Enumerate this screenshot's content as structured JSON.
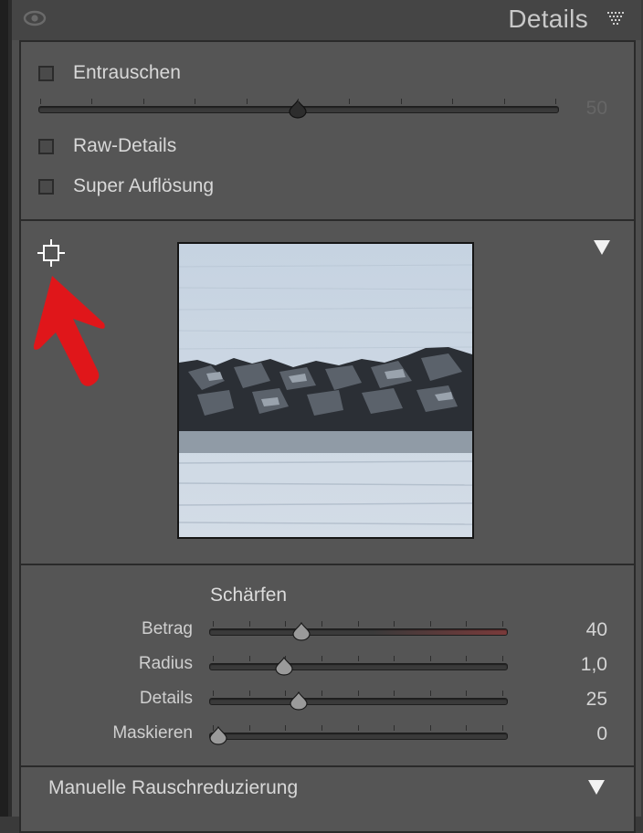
{
  "header": {
    "title": "Details"
  },
  "noise": {
    "checkbox_label": "Entrauschen",
    "slider_value": "50",
    "slider_fraction": 0.5
  },
  "raw_details": {
    "label": "Raw-Details"
  },
  "super_res": {
    "label": "Super Auflösung"
  },
  "sharpening": {
    "title": "Schärfen",
    "sliders": [
      {
        "label": "Betrag",
        "value": "40",
        "fraction": 0.28
      },
      {
        "label": "Radius",
        "value": "1,0",
        "fraction": 0.22
      },
      {
        "label": "Details",
        "value": "25",
        "fraction": 0.27
      },
      {
        "label": "Maskieren",
        "value": "0",
        "fraction": 0.0
      }
    ]
  },
  "manual_noise": {
    "label": "Manuelle Rauschreduzierung"
  },
  "colors": {
    "panel": "#4e4e4e",
    "accent_red": "#e0161a",
    "betrag_track_highlight": "#7a3a3a"
  },
  "icons": [
    "eye-icon",
    "panel-menu-icon",
    "target-adjust-icon",
    "collapse-triangle-icon"
  ]
}
